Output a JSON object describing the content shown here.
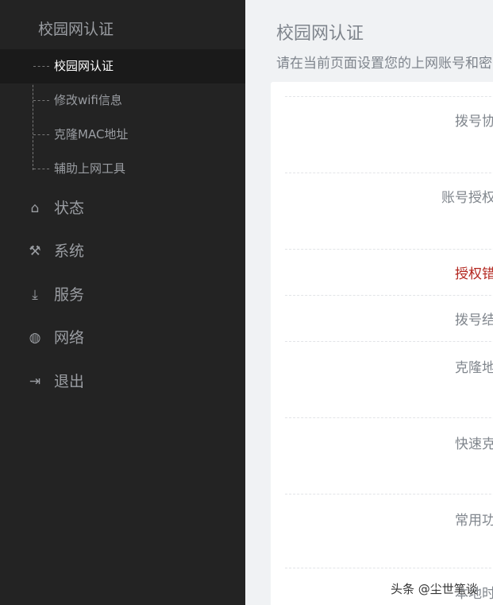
{
  "sidebar": {
    "section_title": "校园网认证",
    "sub_items": [
      {
        "label": "校园网认证",
        "active": true
      },
      {
        "label": "修改wifi信息"
      },
      {
        "label": "克隆MAC地址"
      },
      {
        "label": "辅助上网工具"
      }
    ],
    "nav": [
      {
        "label": "状态",
        "icon": "home-icon"
      },
      {
        "label": "系统",
        "icon": "tools-icon"
      },
      {
        "label": "服务",
        "icon": "download-icon"
      },
      {
        "label": "网络",
        "icon": "globe-icon"
      },
      {
        "label": "退出",
        "icon": "logout-icon"
      }
    ]
  },
  "main": {
    "title": "校园网认证",
    "description": "请在当前页面设置您的上网账号和密",
    "rows": [
      {
        "label": "拨号协议"
      },
      {
        "label": "账号授权码"
      },
      {
        "label": "授权错误",
        "error": true
      },
      {
        "label": "拨号结果"
      },
      {
        "label": "克隆地址"
      },
      {
        "label": "快速克隆"
      },
      {
        "label": "常用功能"
      },
      {
        "label": "本地时间"
      }
    ]
  },
  "watermark": "头条 @尘世笔谈",
  "colors": {
    "sidebar_bg": "#232323",
    "error": "#b3261e",
    "main_bg": "#f0f2f4"
  }
}
